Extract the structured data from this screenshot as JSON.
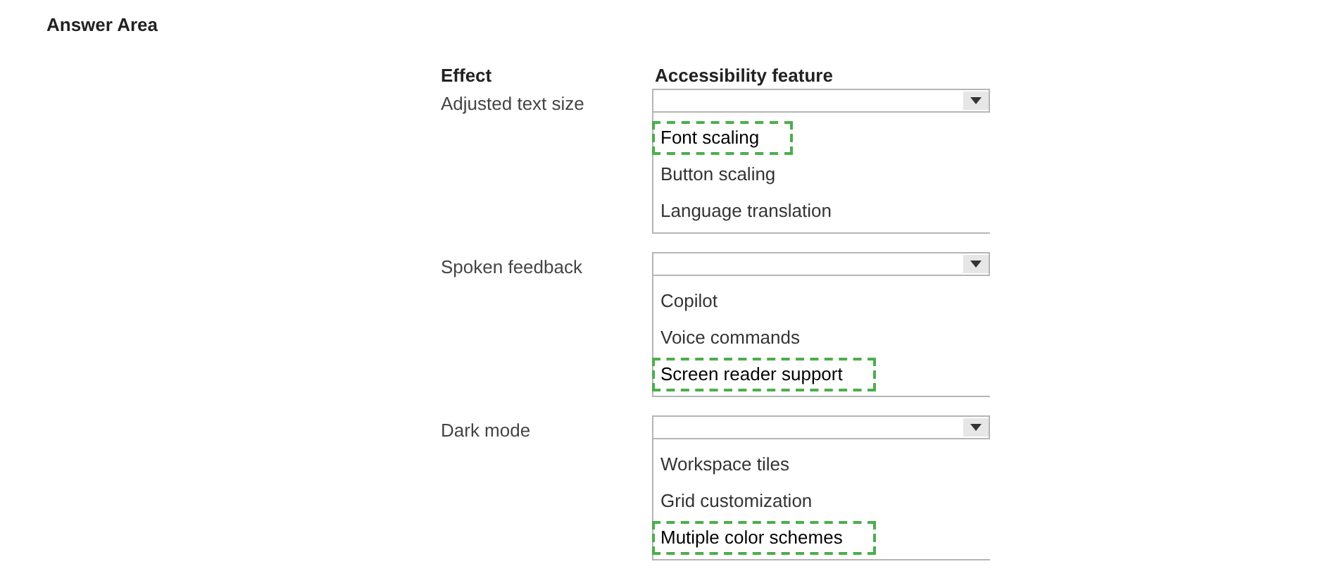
{
  "title": "Answer Area",
  "columns": [
    "Effect",
    "Accessibility feature"
  ],
  "rows": [
    {
      "effect": "Adjusted text size",
      "options": [
        {
          "label": "Font scaling",
          "selected": true
        },
        {
          "label": "Button scaling",
          "selected": false
        },
        {
          "label": "Language translation",
          "selected": false
        }
      ]
    },
    {
      "effect": "Spoken feedback",
      "options": [
        {
          "label": "Copilot",
          "selected": false
        },
        {
          "label": "Voice commands",
          "selected": false
        },
        {
          "label": "Screen reader support",
          "selected": true
        }
      ]
    },
    {
      "effect": "Dark mode",
      "options": [
        {
          "label": "Workspace tiles",
          "selected": false
        },
        {
          "label": "Grid customization",
          "selected": false
        },
        {
          "label": "Mutiple color schemes",
          "selected": true
        }
      ]
    }
  ]
}
